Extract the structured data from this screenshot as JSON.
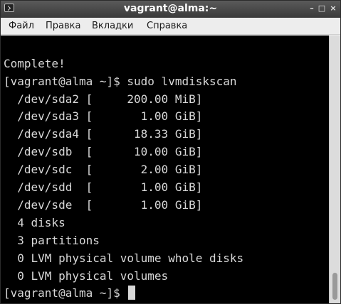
{
  "window": {
    "title": "vagrant@alma:~",
    "icon": "terminal-icon",
    "controls": {
      "minimize": "–",
      "maximize": "□",
      "close": "×"
    }
  },
  "menu": {
    "items": [
      "Файл",
      "Правка",
      "Вкладки",
      "Справка"
    ]
  },
  "terminal": {
    "lines": [
      "",
      "Complete!",
      "[vagrant@alma ~]$ sudo lvmdiskscan",
      "  /dev/sda2 [     200.00 MiB]",
      "  /dev/sda3 [       1.00 GiB]",
      "  /dev/sda4 [      18.33 GiB]",
      "  /dev/sdb  [      10.00 GiB]",
      "  /dev/sdc  [       2.00 GiB]",
      "  /dev/sdd  [       1.00 GiB]",
      "  /dev/sde  [       1.00 GiB]",
      "  4 disks",
      "  3 partitions",
      "  0 LVM physical volume whole disks",
      "  0 LVM physical volumes"
    ],
    "prompt": "[vagrant@alma ~]$ "
  },
  "colors": {
    "terminal_bg": "#000000",
    "terminal_fg": "#d8d8d8",
    "titlebar": "#4a4a4a"
  }
}
